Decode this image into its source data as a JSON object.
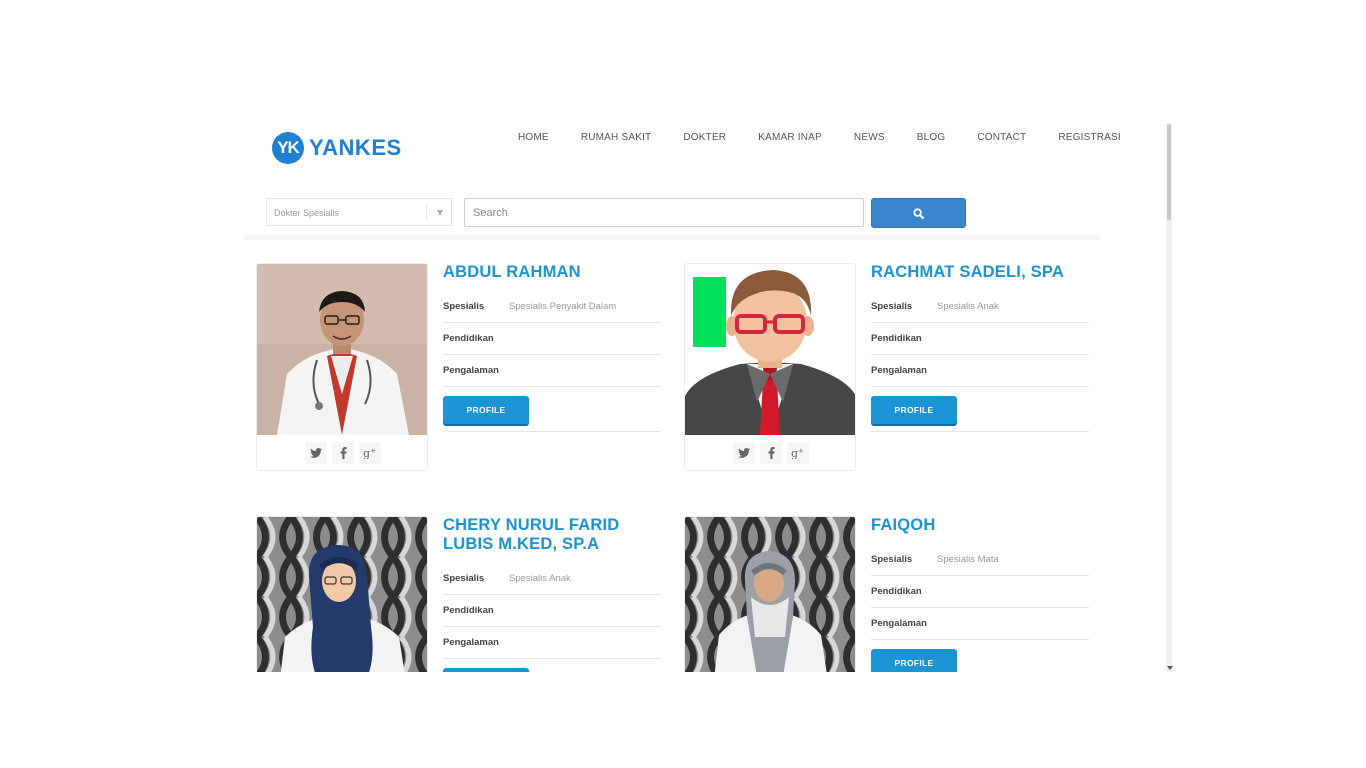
{
  "brand": {
    "badge": "YK",
    "name": "YANKES"
  },
  "nav": [
    "HOME",
    "RUMAH SAKIT",
    "DOKTER",
    "KAMAR INAP",
    "NEWS",
    "BLOG",
    "CONTACT",
    "REGISTRASI"
  ],
  "filter": {
    "selected": "Dokter Spesialis"
  },
  "search": {
    "placeholder": "Search"
  },
  "labels": {
    "spesialis": "Spesialis",
    "pendidikan": "Pendidikan",
    "pengalaman": "Pengalaman",
    "profile": "PROFILE"
  },
  "doctors": [
    {
      "name": "ABDUL RAHMAN",
      "spesialis": "Spesialis Penyakit Dalam"
    },
    {
      "name": "RACHMAT SADELI, SPA",
      "spesialis": "Spesialis Anak"
    },
    {
      "name": "CHERY NURUL FARID LUBIS M.KED, SP.A",
      "spesialis": "Spesialis Anak"
    },
    {
      "name": "FAIQOH",
      "spesialis": "Spesialis Mata"
    }
  ],
  "colors": {
    "accent": "#1a94d2",
    "brand": "#1f7fd0",
    "search_button": "#3b85cf"
  }
}
